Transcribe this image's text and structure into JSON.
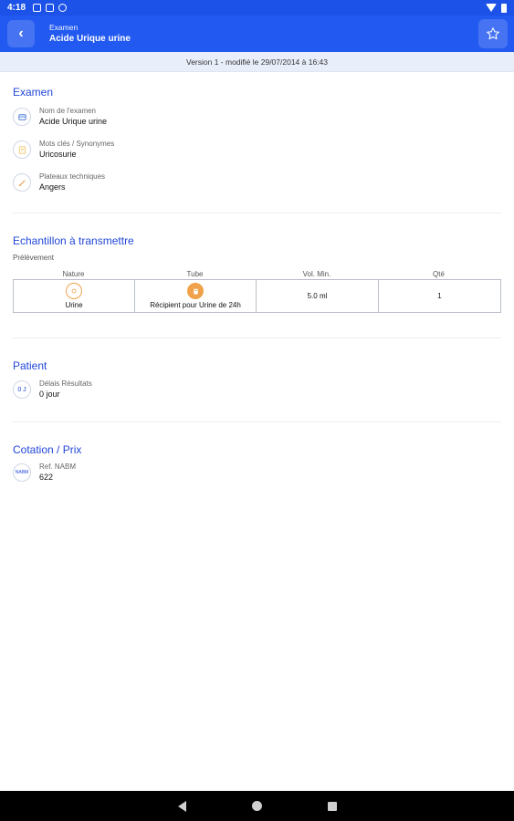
{
  "status_bar": {
    "time": "4:18"
  },
  "app_bar": {
    "subtitle": "Examen",
    "title": "Acide Urique urine"
  },
  "version_bar": {
    "text": "Version 1 - modifié le 29/07/2014 à 16:43"
  },
  "examen": {
    "title": "Examen",
    "fields": [
      {
        "label": "Nom de l'examen",
        "value": "Acide Urique urine",
        "icon": "flask-icon"
      },
      {
        "label": "Mots clés / Synonymes",
        "value": "Uricosurie",
        "icon": "keyword-icon"
      },
      {
        "label": "Plateaux techniques",
        "value": "Angers",
        "icon": "pipette-icon"
      }
    ]
  },
  "echantillon": {
    "title": "Echantillon à transmettre",
    "subhead": "Prélèvement",
    "columns": [
      "Nature",
      "Tube",
      "Vol. Min.",
      "Qté"
    ],
    "row": {
      "nature": "Urine",
      "tube": "Récipient pour Urine de 24h",
      "vol_min": "5.0 ml",
      "qte": "1"
    }
  },
  "patient": {
    "title": "Patient",
    "field": {
      "label": "Délais Résultats",
      "value": "0 jour",
      "icon_text": "0 J"
    }
  },
  "cotation": {
    "title": "Cotation / Prix",
    "field": {
      "label": "Ref. NABM",
      "value": "622",
      "icon_text": "NABM"
    }
  },
  "colors": {
    "primary": "#2259f0",
    "accent_text": "#2247d8",
    "orange": "#f0a24a"
  }
}
